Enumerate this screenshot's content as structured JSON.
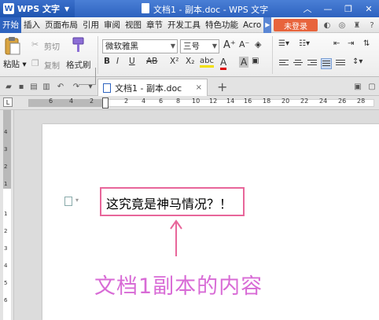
{
  "titlebar": {
    "app_name": "WPS 文字",
    "window_title": "文档1 - 副本.doc - WPS 文字"
  },
  "menu": {
    "items": [
      "开始",
      "插入",
      "页面布局",
      "引用",
      "审阅",
      "视图",
      "章节",
      "开发工具",
      "特色功能",
      "Acro"
    ],
    "login_label": "未登录"
  },
  "ribbon": {
    "paste_label": "粘贴",
    "cut_label": "剪切",
    "copy_label": "复制",
    "format_painter_label": "格式刷",
    "font_name": "微软雅黑",
    "font_size": "三号",
    "bold": "B",
    "italic": "I",
    "underline": "U",
    "strike": "AB",
    "superscript": "X²",
    "subscript": "X₂",
    "highlight": "abc",
    "font_color": "A",
    "char_shading": "A"
  },
  "tabs": {
    "doc_tab_label": "文档1 - 副本.doc",
    "close": "×",
    "new_tab": "+"
  },
  "ruler": {
    "h_numbers": [
      "6",
      "4",
      "2",
      "2",
      "4",
      "6",
      "8",
      "10",
      "12",
      "14",
      "16",
      "18",
      "20",
      "22",
      "24",
      "26",
      "28"
    ],
    "v_numbers": [
      "4",
      "3",
      "2",
      "1",
      "1",
      "2",
      "3",
      "4",
      "5",
      "6"
    ],
    "corner": "L"
  },
  "document": {
    "body_text": "这究竟是神马情况？！",
    "annotation_caption": "文档1副本的内容",
    "annotation_color": "#d86bd6",
    "highlight_color": "#e8669a"
  },
  "colors": {
    "title_bar": "#2e63bf",
    "login_button": "#e8643c"
  }
}
